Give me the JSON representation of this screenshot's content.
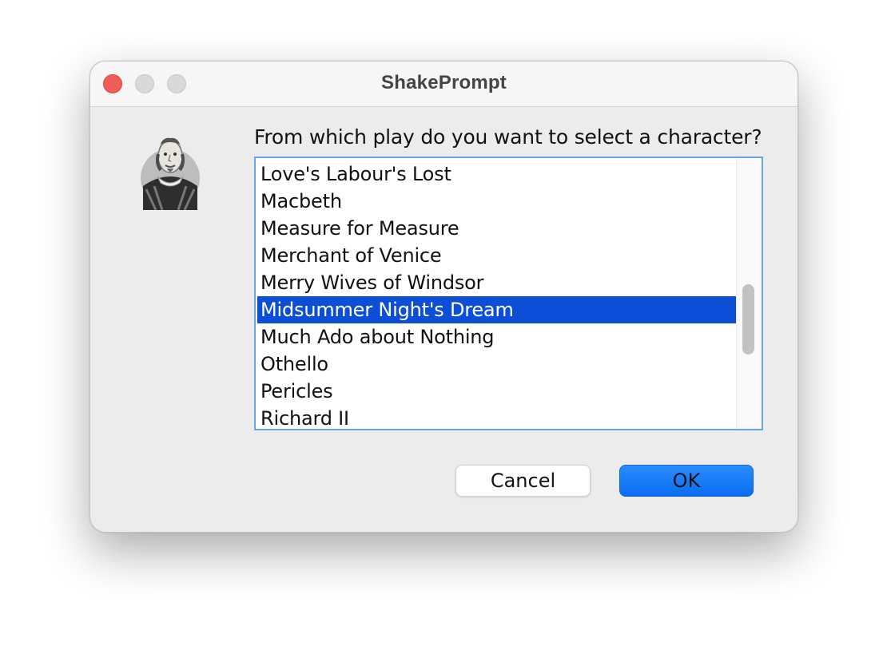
{
  "window": {
    "title": "ShakePrompt"
  },
  "dialog": {
    "prompt": "From which play do you want to select a character?",
    "icon": "shakespeare-portrait"
  },
  "plays": {
    "items": [
      {
        "label": "Love's Labour's Lost"
      },
      {
        "label": "Macbeth"
      },
      {
        "label": "Measure for Measure"
      },
      {
        "label": "Merchant of Venice"
      },
      {
        "label": "Merry Wives of Windsor"
      },
      {
        "label": "Midsummer Night's Dream"
      },
      {
        "label": "Much Ado about Nothing"
      },
      {
        "label": "Othello"
      },
      {
        "label": "Pericles"
      },
      {
        "label": "Richard II"
      }
    ],
    "selected": "Midsummer Night's Dream"
  },
  "buttons": {
    "cancel_label": "Cancel",
    "ok_label": "OK"
  },
  "colors": {
    "selection": "#0c4fd6",
    "accent": "#0a6df2",
    "close": "#ee5e56"
  }
}
